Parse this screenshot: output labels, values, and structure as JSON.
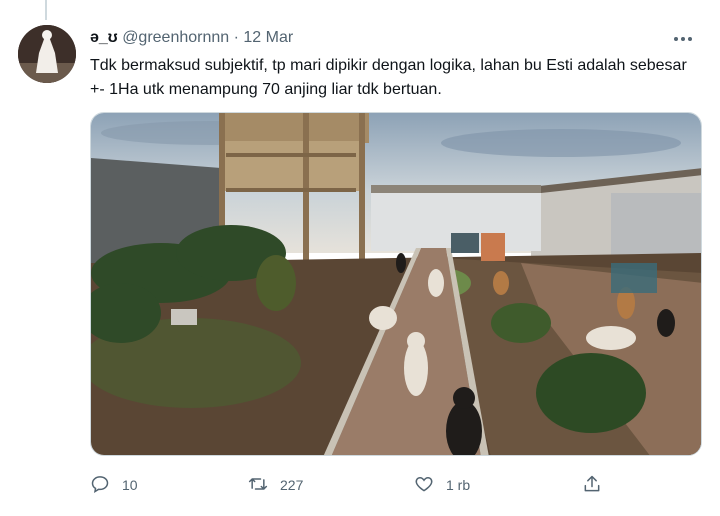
{
  "tweet": {
    "display_name": "ə_ʊ",
    "handle": "@greenhornnn",
    "separator": "·",
    "date": "12 Mar",
    "text": "Tdk bermaksud subjektif, tp mari dipikir dengan logika, lahan bu Esti adalah sebesar +- 1Ha utk menampung 70 anjing liar tdk bertuan."
  },
  "actions": {
    "reply_count": "10",
    "retweet_count": "227",
    "like_count": "1 rb"
  },
  "icons": {
    "more": "more-horizontal-icon",
    "reply": "reply-icon",
    "retweet": "retweet-icon",
    "like": "heart-icon",
    "share": "share-icon"
  },
  "colors": {
    "secondary_text": "#536471",
    "divider": "#cfd9de"
  }
}
